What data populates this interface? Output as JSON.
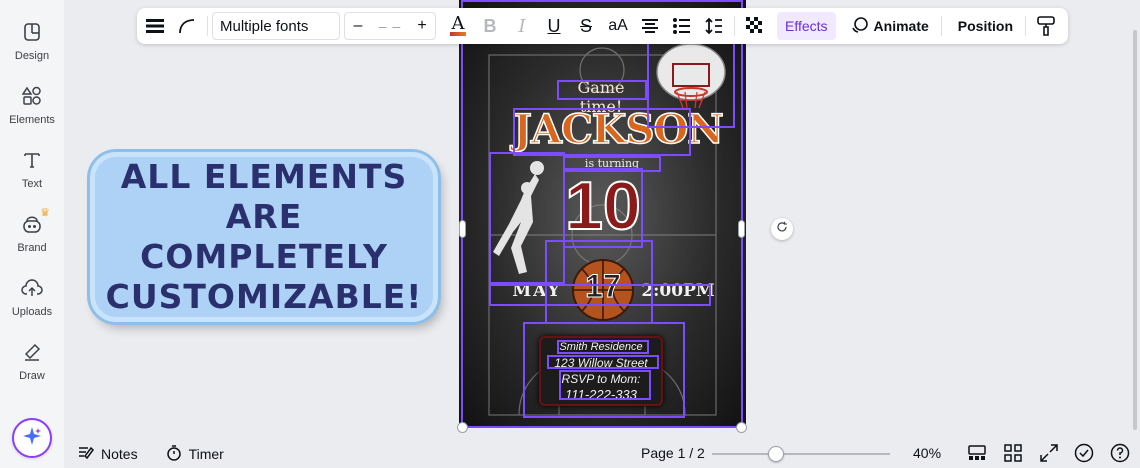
{
  "sidebar": {
    "items": [
      {
        "label": "Design",
        "icon": "design-icon"
      },
      {
        "label": "Elements",
        "icon": "elements-icon"
      },
      {
        "label": "Text",
        "icon": "text-icon"
      },
      {
        "label": "Brand",
        "icon": "brand-icon"
      },
      {
        "label": "Uploads",
        "icon": "uploads-icon"
      },
      {
        "label": "Draw",
        "icon": "draw-icon"
      }
    ]
  },
  "toolbar": {
    "font": "Multiple fonts",
    "size_minus": "–",
    "size_value": "– –",
    "size_plus": "+",
    "effects": "Effects",
    "animate": "Animate",
    "position": "Position",
    "text_color": "#c0392b"
  },
  "design": {
    "heading": "Game time!",
    "name": "JACKSON",
    "subheading": "is turning",
    "age": "10",
    "month": "MAY",
    "day": "17",
    "time": "2:00PM",
    "rsvp_lines": [
      "Smith Residence",
      "123 Willow Street",
      "RSVP to Mom:",
      "111-222-333"
    ]
  },
  "callout": {
    "text": "ALL ELEMENTS ARE COMPLETELY CUSTOMIZABLE!"
  },
  "bottombar": {
    "notes": "Notes",
    "timer": "Timer",
    "page": "Page 1 / 2",
    "zoom": "40%",
    "zoom_level": 0.4
  },
  "colors": {
    "accent": "#8b3dff",
    "selection": "#7c4dff",
    "name_orange": "#d9661f",
    "age_red": "#8b1a1a"
  }
}
